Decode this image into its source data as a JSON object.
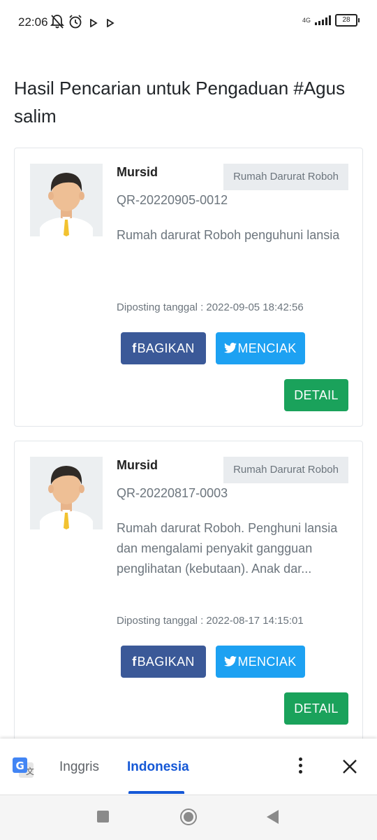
{
  "status": {
    "time": "22:06",
    "network": "4G",
    "battery": "28",
    "icons": [
      "bell-off-icon",
      "alarm-icon",
      "play-icon",
      "play-icon"
    ]
  },
  "page": {
    "title": "Hasil Pencarian untuk Pengaduan #Agus salim"
  },
  "reports": [
    {
      "name": "Mursid",
      "category": "Rumah Darurat Roboh",
      "code": "QR-20220905-0012",
      "description": "Rumah darurat Roboh penguhuni lansia",
      "posted": "Diposting tanggal : 2022-09-05 18:42:56",
      "share_label": "BAGIKAN",
      "tweet_label": "MENCIAK",
      "detail_label": "DETAIL"
    },
    {
      "name": "Mursid",
      "category": "Rumah Darurat Roboh",
      "code": "QR-20220817-0003",
      "description": "Rumah darurat Roboh. Penghuni lansia dan mengalami penyakit gangguan penglihatan (kebutaan). Anak dar...",
      "posted": "Diposting tanggal : 2022-08-17 14:15:01",
      "share_label": "BAGIKAN",
      "tweet_label": "MENCIAK",
      "detail_label": "DETAIL"
    }
  ],
  "translate": {
    "source_lang": "Inggris",
    "target_lang": "Indonesia"
  },
  "colors": {
    "facebook": "#3b5998",
    "twitter": "#1da1f2",
    "detail": "#1aa25b",
    "translate_active": "#1558d6"
  }
}
